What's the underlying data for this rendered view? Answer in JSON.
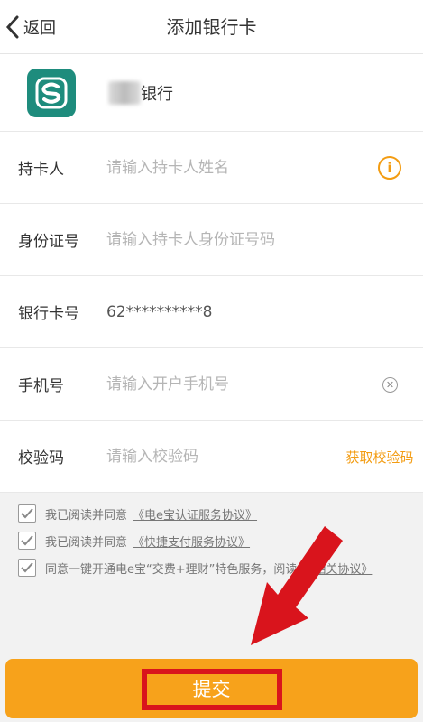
{
  "header": {
    "back_label": "返回",
    "title": "添加银行卡"
  },
  "bank": {
    "name": "银行"
  },
  "fields": {
    "holder": {
      "label": "持卡人",
      "placeholder": "请输入持卡人姓名"
    },
    "id": {
      "label": "身份证号",
      "placeholder": "请输入持卡人身份证号码"
    },
    "card": {
      "label": "银行卡号",
      "value": "62**********8"
    },
    "phone": {
      "label": "手机号",
      "placeholder": "请输入开户手机号"
    },
    "code": {
      "label": "校验码",
      "placeholder": "请输入校验码",
      "button": "获取校验码"
    }
  },
  "agreements": [
    {
      "text": "我已阅读并同意",
      "link": "《电e宝认证服务协议》"
    },
    {
      "text": "我已阅读并同意",
      "link": "《快捷支付服务协议》"
    },
    {
      "text": "同意一键开通电e宝“交费+理财”特色服务，阅读",
      "link": "《相关协议》"
    }
  ],
  "submit_label": "提交",
  "colors": {
    "accent": "#f7a21b",
    "highlight": "#d9141c",
    "logo": "#1e8c7d"
  }
}
